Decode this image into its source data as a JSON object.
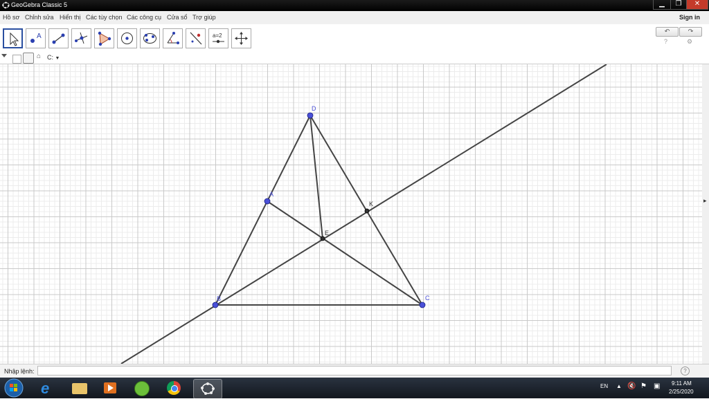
{
  "window": {
    "title": "GeoGebra Classic 5",
    "controls": [
      "▁",
      "❐",
      "✕"
    ]
  },
  "menu": {
    "items": [
      "Hồ sơ",
      "Chỉnh sửa",
      "Hiển thị",
      "Các tùy chọn",
      "Các công cụ",
      "Cửa sổ",
      "Trợ giúp"
    ],
    "sign_in": "Sign in"
  },
  "toolbar": {
    "tools": [
      "move-tool",
      "point-tool",
      "segment-tool",
      "perpendicular-tool",
      "polygon-tool",
      "circle-tool",
      "ellipse-tool",
      "angle-tool",
      "reflect-tool",
      "slider-tool",
      "move-view-tool"
    ],
    "selected": "move-tool",
    "slider_text": "a=2",
    "undo_icon": "undo-icon",
    "redo_icon": "redo-icon"
  },
  "stylebar": {
    "coord_label": "C:"
  },
  "geometry": {
    "points": [
      {
        "name": "D",
        "style": "free"
      },
      {
        "name": "A",
        "style": "free"
      },
      {
        "name": "K",
        "style": "dependent"
      },
      {
        "name": "E",
        "style": "dependent"
      },
      {
        "name": "B",
        "style": "free"
      },
      {
        "name": "C",
        "style": "free"
      }
    ],
    "colors": {
      "free_point": "#4a50d8",
      "dependent_point": "#333333",
      "line": "#444444",
      "label_free": "#4a50d8",
      "label_dependent": "#333333"
    }
  },
  "input_bar": {
    "label": "Nhập lệnh:",
    "value": "",
    "help_icon": "help-icon"
  },
  "taskbar": {
    "language": "EN",
    "time": "9:11 AM",
    "date": "2/25/2020",
    "apps": [
      "start-button",
      "internet-explorer-icon",
      "file-explorer-icon",
      "media-player-icon",
      "cococ-browser-icon",
      "chrome-icon",
      "geogebra-icon"
    ]
  }
}
